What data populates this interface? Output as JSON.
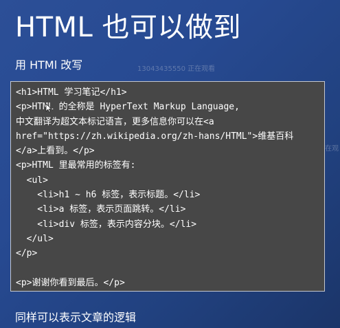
{
  "slide": {
    "title": "HTML 也可以做到",
    "subtitle": "用 HTMl 改写",
    "caption": "同样可以表示文章的逻辑"
  },
  "watermarks": [
    "13043435550 正在观看",
    "13043435550 正在观"
  ],
  "code": {
    "lines": [
      "<h1>HTML 学习笔记</h1>",
      "<p>HTML 的全称是 HyperText Markup Language,",
      "中文翻译为超文本标记语言，更多信息你可以在<a",
      "href=\"https://zh.wikipedia.org/zh-hans/HTML\">维基百科",
      "</a>上看到。</p>",
      "<p>HTML 里最常用的标签有:",
      "  <ul>",
      "    <li>h1 ~ h6 标签，表示标题。</li>",
      "    <li>a 标签，表示页面跳转。</li>",
      "    <li>div 标签，表示内容分块。</li>",
      "  </ul>",
      "</p>",
      "",
      "<p>谢谢你看到最后。</p>"
    ]
  },
  "icons": {
    "cursor": "mouse-pointer-icon"
  },
  "colors": {
    "background": "#274a92",
    "code_background": "#474747",
    "code_border": "#c5c8cf",
    "text": "#ffffff"
  }
}
